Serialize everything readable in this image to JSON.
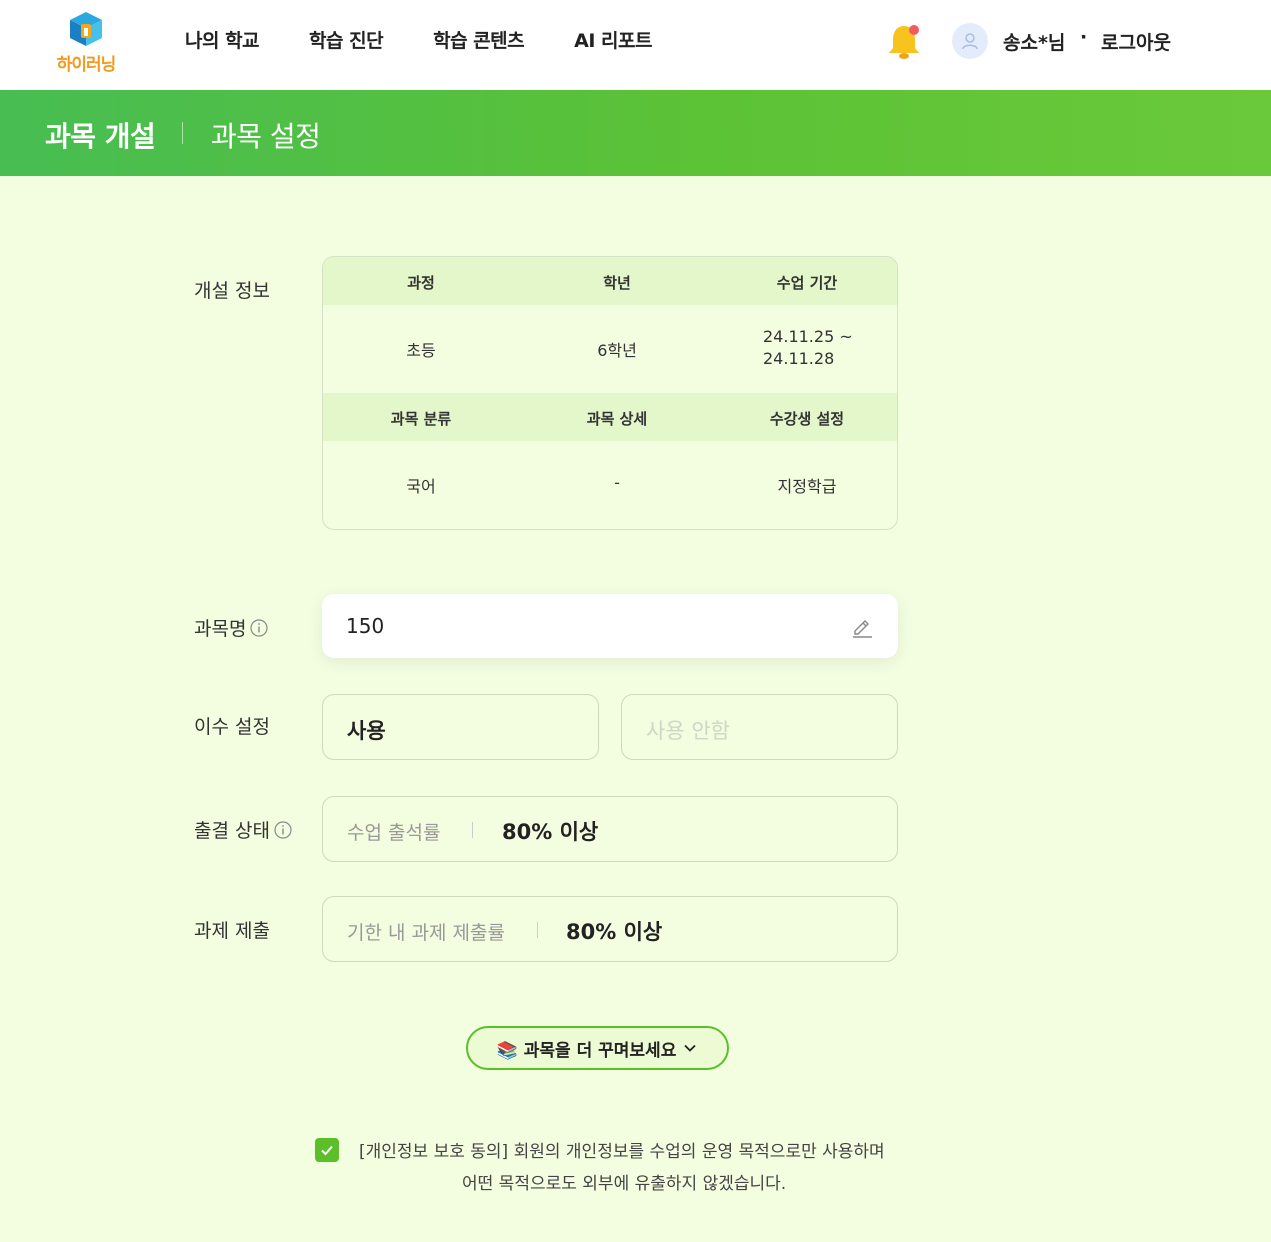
{
  "header": {
    "logo_text": "하이러닝",
    "nav": [
      "나의 학교",
      "학습 진단",
      "학습 콘텐츠",
      "AI 리포트"
    ],
    "user_name": "송소*님",
    "separator": "·",
    "logout": "로그아웃"
  },
  "banner": {
    "title": "과목 개설",
    "subtitle": "과목 설정"
  },
  "info": {
    "label": "개설 정보",
    "row1_headers": [
      "과정",
      "학년",
      "수업 기간"
    ],
    "row1_values": [
      "초등",
      "6학년",
      "24.11.25 ~\n24.11.28"
    ],
    "row2_headers": [
      "과목 분류",
      "과목 상세",
      "수강생 설정"
    ],
    "row2_values": [
      "국어",
      "-",
      "지정학급"
    ]
  },
  "subject_name": {
    "label": "과목명",
    "value": "150"
  },
  "completion": {
    "label": "이수 설정",
    "use": "사용",
    "no_use": "사용 안함"
  },
  "attendance": {
    "label": "출결 상태",
    "field_label": "수업 출석률",
    "value": "80% 이상"
  },
  "assignment": {
    "label": "과제 제출",
    "field_label": "기한 내 과제 제출률",
    "value": "80% 이상"
  },
  "more_button": "📚 과목을 더 꾸며보세요",
  "consent": {
    "line1": "[개인정보 보호 동의] 회원의 개인정보를 수업의 운영 목적으로만 사용하며",
    "line2": "어떤 목적으로도 외부에 유출하지 않겠습니다."
  },
  "colors": {
    "accent": "#5cbf2a",
    "background": "#f3fde0",
    "header_cell": "#e4f7cb"
  }
}
